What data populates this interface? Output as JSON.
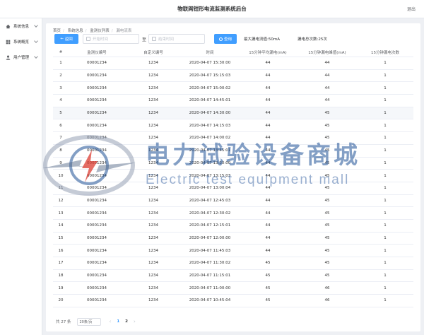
{
  "app": {
    "title": "物联网钳形电流监测系统后台",
    "logout": "退出"
  },
  "sidebar": {
    "items": [
      {
        "label": "系统信息",
        "icon": "home-icon"
      },
      {
        "label": "系统概览",
        "icon": "grid-icon"
      },
      {
        "label": "用户管理",
        "icon": "user-icon"
      }
    ]
  },
  "breadcrumb": [
    "首页",
    "系统信息",
    "监测仪列表",
    "漏电流表"
  ],
  "filters": {
    "back_label": "返回",
    "start_placeholder": "开始时间",
    "to_label": "至",
    "end_placeholder": "结束时间",
    "query_label": "查询",
    "max_leak": "最大漏电流值:50mA",
    "leak_count": "漏电总次数:25次"
  },
  "table": {
    "headers": [
      "#",
      "监测仪编号",
      "自定义编号",
      "时间",
      "15分钟平均漏电(mA)",
      "15分钟漏电峰值(mA)",
      "15分钟漏电次数"
    ],
    "rows": [
      [
        "1",
        "00001234",
        "1234",
        "2020-04-07 15:30:00",
        "44",
        "44",
        "1"
      ],
      [
        "2",
        "00001234",
        "1234",
        "2020-04-07 15:15:03",
        "44",
        "44",
        "1"
      ],
      [
        "3",
        "00001234",
        "1234",
        "2020-04-07 15:00:02",
        "44",
        "44",
        "1"
      ],
      [
        "4",
        "00001234",
        "1234",
        "2020-04-07 14:45:01",
        "44",
        "44",
        "1"
      ],
      [
        "5",
        "00001234",
        "1234",
        "2020-04-07 14:30:00",
        "44",
        "45",
        "1"
      ],
      [
        "6",
        "00001234",
        "1234",
        "2020-04-07 14:15:03",
        "44",
        "45",
        "1"
      ],
      [
        "7",
        "00001234",
        "1234",
        "2020-04-07 14:00:02",
        "44",
        "45",
        "1"
      ],
      [
        "8",
        "00001234",
        "1234",
        "2020-04-07 13:45:01",
        "44",
        "45",
        "1"
      ],
      [
        "9",
        "00001234",
        "1234",
        "2020-04-07 13:30:00",
        "44",
        "45",
        "1"
      ],
      [
        "10",
        "00001234",
        "1234",
        "2020-04-07 13:15:03",
        "44",
        "45",
        "1"
      ],
      [
        "11",
        "00001234",
        "1234",
        "2020-04-07 13:00:04",
        "44",
        "45",
        "1"
      ],
      [
        "12",
        "00001234",
        "1234",
        "2020-04-07 12:45:03",
        "44",
        "45",
        "1"
      ],
      [
        "13",
        "00001234",
        "1234",
        "2020-04-07 12:30:02",
        "44",
        "45",
        "1"
      ],
      [
        "14",
        "00001234",
        "1234",
        "2020-04-07 12:15:01",
        "44",
        "45",
        "1"
      ],
      [
        "15",
        "00001234",
        "1234",
        "2020-04-07 12:00:00",
        "44",
        "45",
        "1"
      ],
      [
        "16",
        "00001234",
        "1234",
        "2020-04-07 11:45:03",
        "44",
        "45",
        "1"
      ],
      [
        "17",
        "00001234",
        "1234",
        "2020-04-07 11:30:02",
        "45",
        "45",
        "1"
      ],
      [
        "18",
        "00001234",
        "1234",
        "2020-04-07 11:15:01",
        "45",
        "45",
        "1"
      ],
      [
        "19",
        "00001234",
        "1234",
        "2020-04-07 11:00:00",
        "45",
        "46",
        "1"
      ],
      [
        "20",
        "00001234",
        "1234",
        "2020-04-07 10:45:04",
        "45",
        "46",
        "1"
      ]
    ],
    "highlight_row": 5
  },
  "pagination": {
    "total": "共 27 条",
    "page_size": "20条/页",
    "prev": "‹",
    "pages": [
      "1",
      "2"
    ],
    "next": "›"
  },
  "watermark": {
    "cn": "电力试验设备商城",
    "en": "Electric test equipment mall",
    "icon": "lightning-logo-icon"
  },
  "colors": {
    "primary": "#409eff",
    "watermark": "#1e5096"
  }
}
